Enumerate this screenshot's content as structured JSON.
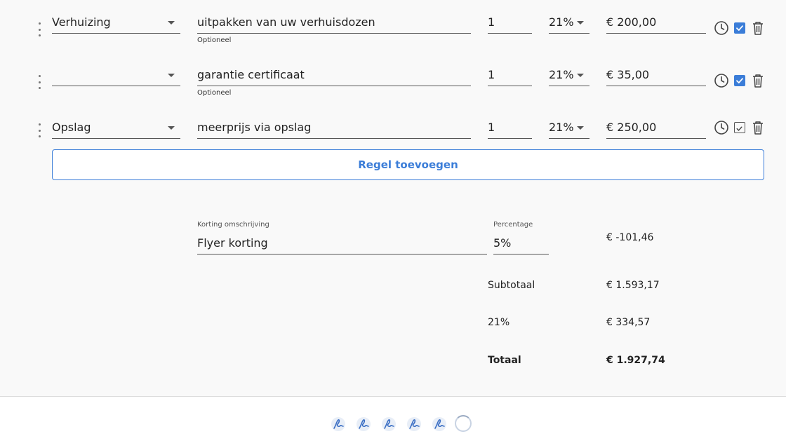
{
  "lines": [
    {
      "category": "Verhuizing",
      "description": "uitpakken van uw verhuisdozen",
      "helper": "Optioneel",
      "quantity": "1",
      "vat": "21%",
      "price": "€ 200,00",
      "checked": true
    },
    {
      "category": "",
      "description": "garantie certificaat",
      "helper": "Optioneel",
      "quantity": "1",
      "vat": "21%",
      "price": "€ 35,00",
      "checked": true
    },
    {
      "category": "Opslag",
      "description": "meerprijs via opslag",
      "helper": "",
      "quantity": "1",
      "vat": "21%",
      "price": "€ 250,00",
      "checked": false
    }
  ],
  "add_line_label": "Regel toevoegen",
  "discount": {
    "description_label": "Korting omschrijving",
    "description_value": "Flyer korting",
    "percentage_label": "Percentage",
    "percentage_value": "5%",
    "amount": "€ -101,46"
  },
  "totals": {
    "subtotal_label": "Subtotaal",
    "subtotal_value": "€ 1.593,17",
    "vat_label": "21%",
    "vat_value": "€ 334,57",
    "total_label": "Totaal",
    "total_value": "€ 1.927,74"
  },
  "icons": {
    "drag": "drag-handle-icon",
    "clock": "clock-icon",
    "check": "checkbox-icon",
    "delete": "trash-icon",
    "signature": "signature-icon",
    "spinner": "loading-spinner-icon"
  },
  "colors": {
    "accent": "#3b7dd8",
    "background": "#f9f9f9"
  }
}
